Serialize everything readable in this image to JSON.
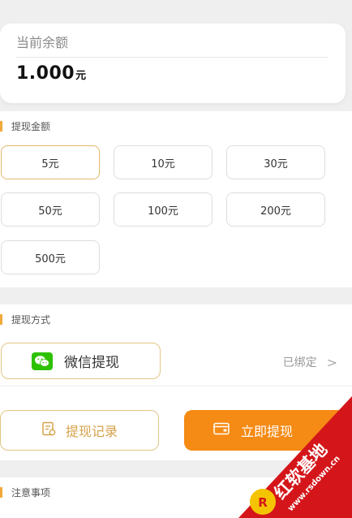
{
  "balance": {
    "label": "当前余额",
    "value": "1.000",
    "unit": "元"
  },
  "amount_section": {
    "title": "提现金额",
    "options": [
      "5元",
      "10元",
      "30元",
      "50元",
      "100元",
      "200元",
      "500元"
    ],
    "selected": "5元"
  },
  "method_section": {
    "title": "提现方式",
    "method_label": "微信提现",
    "bound_status": "已绑定",
    "chevron": ">"
  },
  "actions": {
    "records_label": "提现记录",
    "withdraw_label": "立即提现"
  },
  "notes_section": {
    "title": "注意事项"
  },
  "watermark": {
    "brand": "红软基地",
    "url": "www.rsdown.cn"
  },
  "colors": {
    "accent": "#f58a14",
    "gold": "#e2c585",
    "wechat": "#2dc100",
    "watermark_red": "#d4161a"
  }
}
